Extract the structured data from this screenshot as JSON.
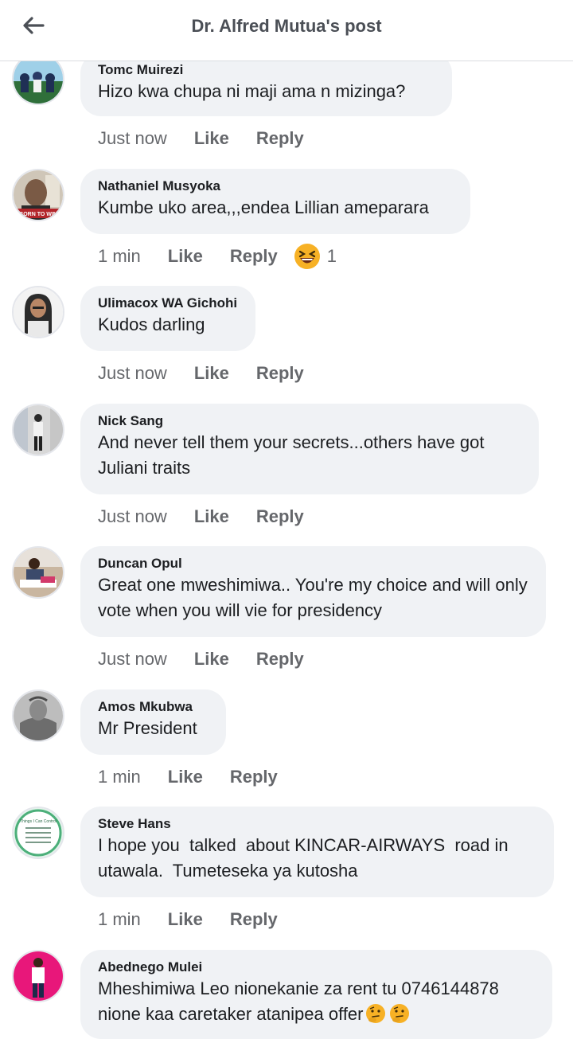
{
  "header": {
    "title": "Dr. Alfred Mutua's post",
    "back_icon": "arrow-left-icon"
  },
  "actions": {
    "like_label": "Like",
    "reply_label": "Reply"
  },
  "comments": [
    {
      "author": "Tomc Muirezi",
      "text": "Hizo kwa chupa ni maji ama n mizinga?",
      "time": "Just now",
      "avatar_colors": [
        "#2f6f3a",
        "#9fd0e8"
      ]
    },
    {
      "author": "Nathaniel Musyoka",
      "text": "Kumbe uko area,,,endea Lillian ameparara",
      "time": "1 min",
      "reaction": {
        "icon": "laughing-emoji-icon",
        "count": "1"
      },
      "avatar_colors": [
        "#7a5a45",
        "#cfc6b8"
      ],
      "avatar_caption": "BORN TO WIN"
    },
    {
      "author": "Ulimacox WA Gichohi",
      "text": "Kudos darling",
      "time": "Just now",
      "avatar_colors": [
        "#2b2b2b",
        "#f3f3f3"
      ]
    },
    {
      "author": "Nick Sang",
      "text": "And never tell them your secrets...others have got Juliani traits",
      "time": "Just now",
      "avatar_colors": [
        "#303030",
        "#d8d8d8"
      ]
    },
    {
      "author": "Duncan Opul",
      "text": "Great one mweshimiwa.. You're my choice and will only vote when you will vie for presidency",
      "time": "Just now",
      "avatar_colors": [
        "#3b4a6b",
        "#c9b6a0"
      ]
    },
    {
      "author": "Amos Mkubwa",
      "text": "Mr President",
      "time": "1 min",
      "avatar_colors": [
        "#6d6d6d",
        "#bdbdbd"
      ]
    },
    {
      "author": "Steve Hans",
      "text": "I hope you  talked  about KINCAR-AIRWAYS  road in utawala.  Tumeteseka ya kutosha",
      "time": "1 min",
      "avatar_colors": [
        "#4caf7a",
        "#dff3e8"
      ],
      "avatar_caption": "Things I Can Control"
    },
    {
      "author": "Abednego Mulei",
      "text": "Mheshimiwa Leo nionekanie za rent tu 0746144878 nione kaa caretaker atanipea offer",
      "text_suffix_icons": [
        "thinking-emoji-icon",
        "thinking-emoji-icon"
      ],
      "avatar_colors": [
        "#e8177a",
        "#ffffff"
      ]
    }
  ]
}
